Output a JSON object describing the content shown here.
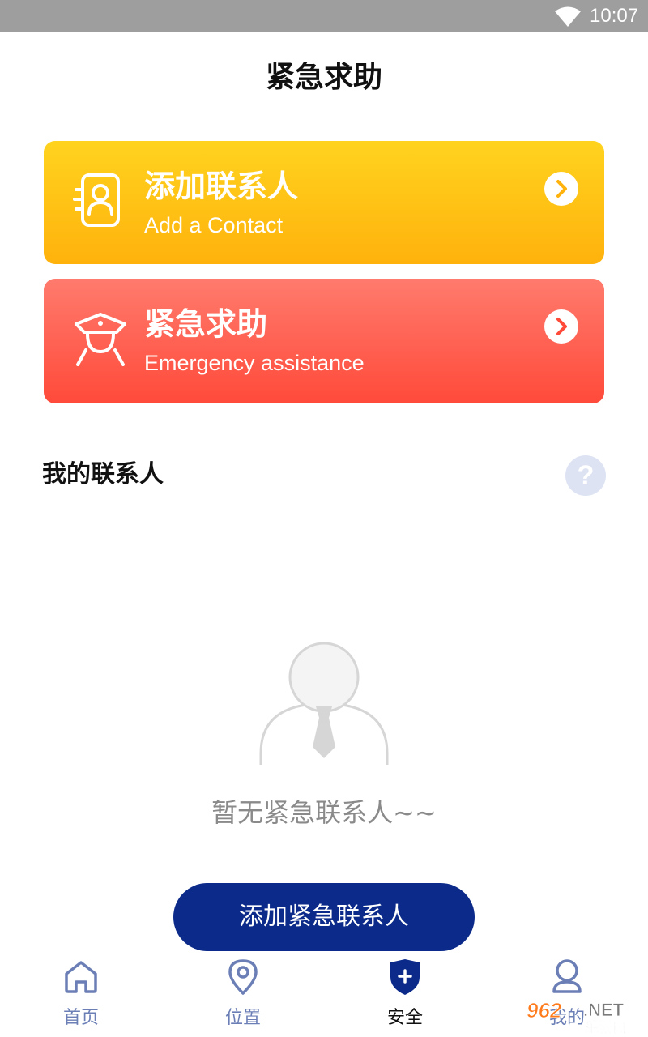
{
  "status_bar": {
    "time": "10:07",
    "wifi_icon": "wifi-icon"
  },
  "page": {
    "title": "紧急求助"
  },
  "cards": [
    {
      "title": "添加联系人",
      "subtitle": "Add a Contact",
      "icon": "contact-card-icon",
      "color_top": "#ffd31f",
      "color_bottom": "#ffb20c"
    },
    {
      "title": "紧急求助",
      "subtitle": "Emergency assistance",
      "icon": "police-officer-icon",
      "color_top": "#ff7b6d",
      "color_bottom": "#ff4a3a"
    }
  ],
  "contacts_section": {
    "title": "我的联系人",
    "help_symbol": "?",
    "empty_text": "暂无紧急联系人~~",
    "add_button_label": "添加紧急联系人"
  },
  "tabbar": {
    "items": [
      {
        "label": "首页",
        "icon": "home-icon",
        "active": false
      },
      {
        "label": "位置",
        "icon": "location-pin-icon",
        "active": false
      },
      {
        "label": "安全",
        "icon": "shield-plus-icon",
        "active": true
      },
      {
        "label": "我的",
        "icon": "user-icon",
        "active": false
      }
    ],
    "inactive_color": "#6b7fb6",
    "active_color": "#0b2a8a"
  },
  "watermark": {
    "text_a": "962",
    "text_b": ".NET",
    "text_c": "乐游网"
  }
}
